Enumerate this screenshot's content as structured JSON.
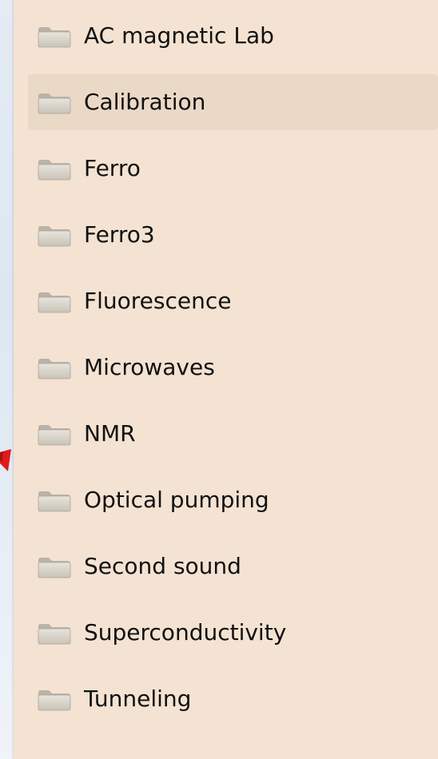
{
  "explorer": {
    "folders": [
      {
        "label": "AC magnetic Lab",
        "icon": "folder-icon",
        "selected": false
      },
      {
        "label": "Calibration",
        "icon": "folder-icon",
        "selected": true
      },
      {
        "label": "Ferro",
        "icon": "folder-icon",
        "selected": false
      },
      {
        "label": "Ferro3",
        "icon": "folder-icon",
        "selected": false
      },
      {
        "label": "Fluorescence",
        "icon": "folder-icon",
        "selected": false
      },
      {
        "label": "Microwaves",
        "icon": "folder-icon",
        "selected": false
      },
      {
        "label": "NMR",
        "icon": "folder-icon",
        "selected": false
      },
      {
        "label": "Optical pumping",
        "icon": "folder-icon",
        "selected": false
      },
      {
        "label": "Second sound",
        "icon": "folder-icon",
        "selected": false
      },
      {
        "label": "Superconductivity",
        "icon": "folder-icon",
        "selected": false
      },
      {
        "label": "Tunneling",
        "icon": "folder-icon",
        "selected": false
      }
    ]
  },
  "colors": {
    "panel_background": "#f4e3d2",
    "selected_background": "#ebd9c7",
    "arrow": "#e01b1b"
  },
  "decorations": {
    "pointer_arrow_icon": "red-arrow-icon"
  }
}
